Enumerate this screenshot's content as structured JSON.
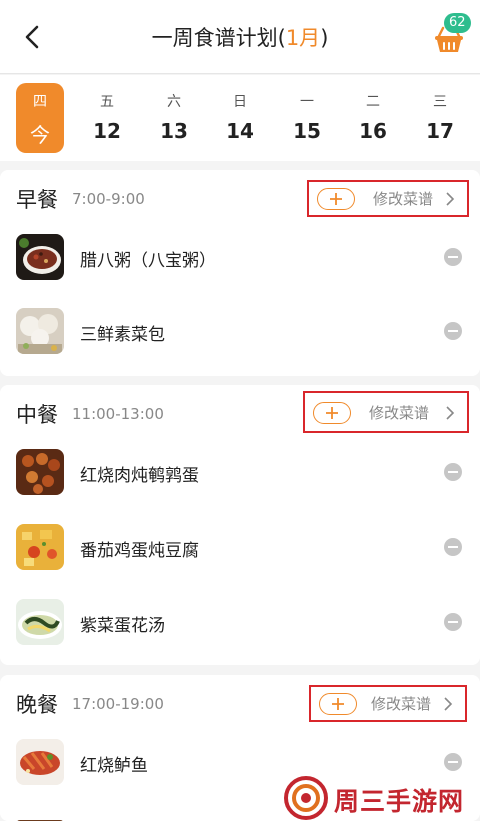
{
  "header": {
    "title_prefix": "一周食谱计划(",
    "title_month": "1月",
    "title_suffix": ")",
    "cart_badge": "62"
  },
  "week": [
    {
      "weekday": "四",
      "date": "今",
      "active": true
    },
    {
      "weekday": "五",
      "date": "12",
      "active": false
    },
    {
      "weekday": "六",
      "date": "13",
      "active": false
    },
    {
      "weekday": "日",
      "date": "14",
      "active": false
    },
    {
      "weekday": "一",
      "date": "15",
      "active": false
    },
    {
      "weekday": "二",
      "date": "16",
      "active": false
    },
    {
      "weekday": "三",
      "date": "17",
      "active": false
    }
  ],
  "meals": {
    "breakfast": {
      "name": "早餐",
      "time": "7:00-9:00",
      "edit_label": "修改菜谱",
      "dishes": [
        {
          "name": "腊八粥（八宝粥）"
        },
        {
          "name": "三鲜素菜包"
        }
      ]
    },
    "lunch": {
      "name": "中餐",
      "time": "11:00-13:00",
      "edit_label": "修改菜谱",
      "dishes": [
        {
          "name": "红烧肉炖鹌鹑蛋"
        },
        {
          "name": "番茄鸡蛋炖豆腐"
        },
        {
          "name": "紫菜蛋花汤"
        }
      ]
    },
    "dinner": {
      "name": "晚餐",
      "time": "17:00-19:00",
      "edit_label": "修改菜谱",
      "dishes": [
        {
          "name": "红烧鲈鱼"
        }
      ]
    }
  },
  "watermark": {
    "text": "周三手游网"
  },
  "colors": {
    "accent": "#f08a2b",
    "badge": "#2ebd8e",
    "highlight_box": "#d9262b",
    "watermark": "#c3262f"
  }
}
